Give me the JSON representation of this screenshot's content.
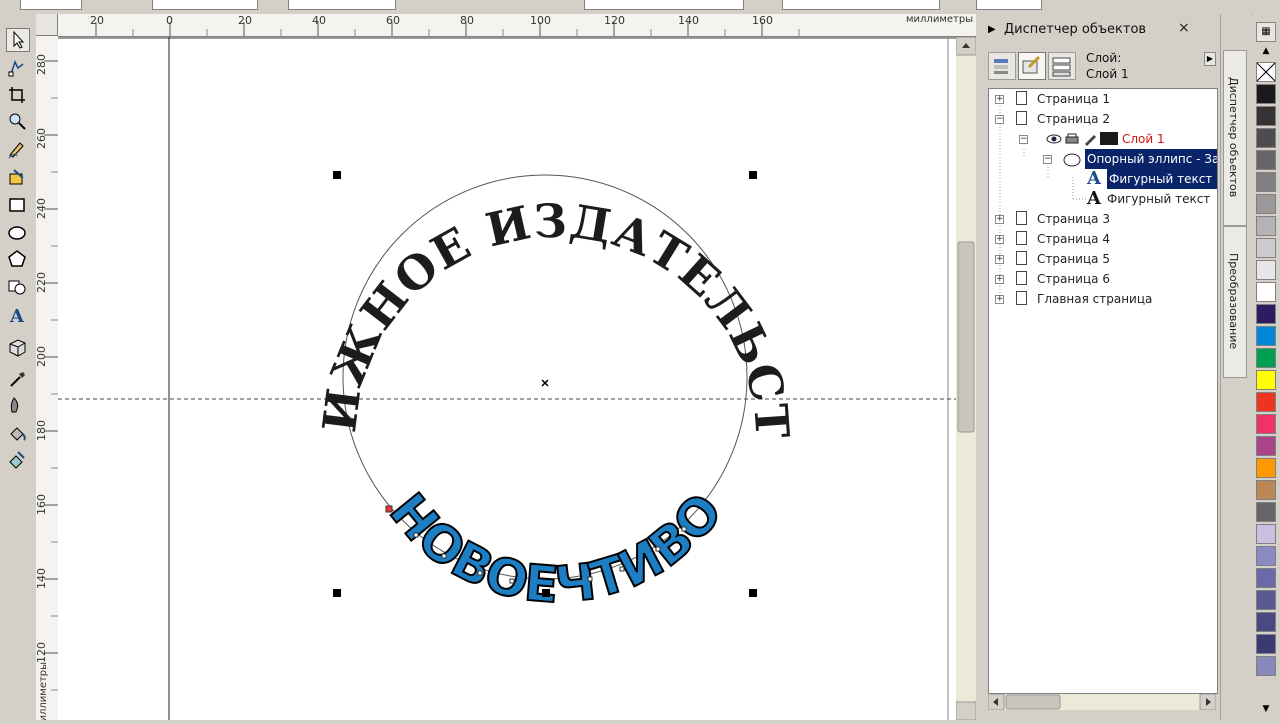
{
  "rulers": {
    "horizontal_labels": [
      "20",
      "0",
      "20",
      "40",
      "60",
      "80",
      "100",
      "120",
      "140",
      "160"
    ],
    "horizontal_unit": "миллиметры",
    "vertical_labels": [
      "280",
      "260",
      "240",
      "220",
      "200",
      "180",
      "160",
      "140",
      "120"
    ],
    "vertical_unit": "миллиметры"
  },
  "canvas": {
    "upper_text": "КНИЖНОЕ ИЗДАТЕЛЬСТВО",
    "lower_text": "НОВОЕЧТИВО",
    "colors": {
      "upper_text": "#1c1c1c",
      "lower_fill": "#1e7ec4",
      "lower_outline": "#000000",
      "ellipse": "#555555"
    }
  },
  "object_manager": {
    "title": "Диспетчер объектов",
    "layer_label": "Слой:",
    "layer_name": "Слой 1",
    "tree": [
      {
        "label": "Страница 1",
        "expander": "+"
      },
      {
        "label": "Страница 2",
        "expander": "−"
      },
      {
        "label": "Слой 1",
        "expander": "−"
      },
      {
        "label": "Опорный эллипс - За",
        "expander": "−"
      },
      {
        "label": "Фигурный текст",
        "icon": "text-icon"
      },
      {
        "label": "Фигурный текст",
        "icon": "text-icon"
      },
      {
        "label": "Страница 3",
        "expander": "+"
      },
      {
        "label": "Страница 4",
        "expander": "+"
      },
      {
        "label": "Страница 5",
        "expander": "+"
      },
      {
        "label": "Страница 6",
        "expander": "+"
      },
      {
        "label": "Главная страница",
        "expander": "+"
      }
    ]
  },
  "dock_tabs": [
    "Диспетчер объектов",
    "Преобразование"
  ],
  "palette": [
    "#ffffff",
    "#1a1a1a",
    "#333333",
    "#4d4d4d",
    "#666666",
    "#808080",
    "#999999",
    "#b3b3b3",
    "#cccccc",
    "#e6e6e6",
    "#ffffff",
    "#2e1a5e",
    "#0088d8",
    "#00a050",
    "#ffff00",
    "#ee3322",
    "#ee3366",
    "#aa4488",
    "#ff9900",
    "#bb8855",
    "#666666",
    "#c8c0e0",
    "#8a8ac0",
    "#6a6aa8",
    "#5a5a90",
    "#4a4a80",
    "#3a3a70",
    "#8888bb"
  ],
  "accent": {
    "selection": "#0a246a",
    "layer_name": "#d01010"
  }
}
